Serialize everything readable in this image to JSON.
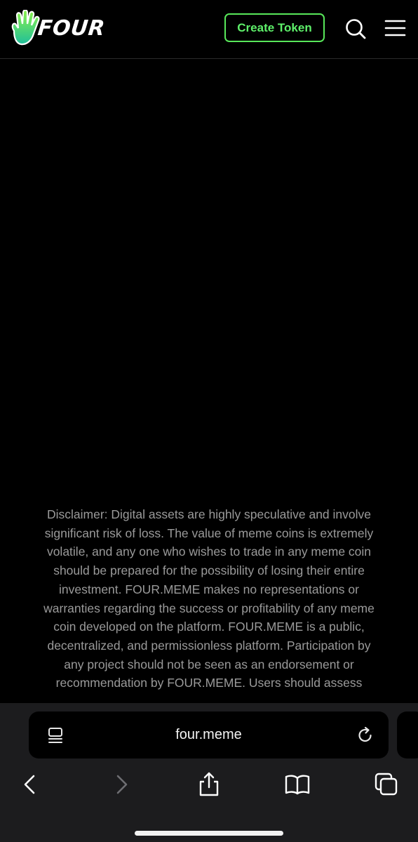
{
  "header": {
    "logo_text": "FOUR",
    "create_token_label": "Create Token"
  },
  "main": {
    "disclaimer": "Disclaimer: Digital assets are highly speculative and involve significant risk of loss. The value of meme coins is extremely volatile, and any one who wishes to trade in any meme coin should be prepared for the possibility of losing their entire investment. FOUR.MEME makes no representations or warranties regarding the success or profitability of any meme coin developed on the platform. FOUR.MEME is a public, decentralized, and permissionless platform. Participation by any project should not be seen as an endorsement or recommendation by FOUR.MEME. Users should assess"
  },
  "browser": {
    "url": "four.meme"
  },
  "colors": {
    "accent": "#58e85a",
    "background": "#000000",
    "disclaimer_text": "#9a9a9a",
    "toolbar": "#1c1c1e"
  },
  "icons": [
    "hand-logo-icon",
    "search-icon",
    "menu-icon",
    "reader-icon",
    "reload-icon",
    "back-icon",
    "forward-icon",
    "share-icon",
    "bookmarks-icon",
    "tabs-icon"
  ]
}
